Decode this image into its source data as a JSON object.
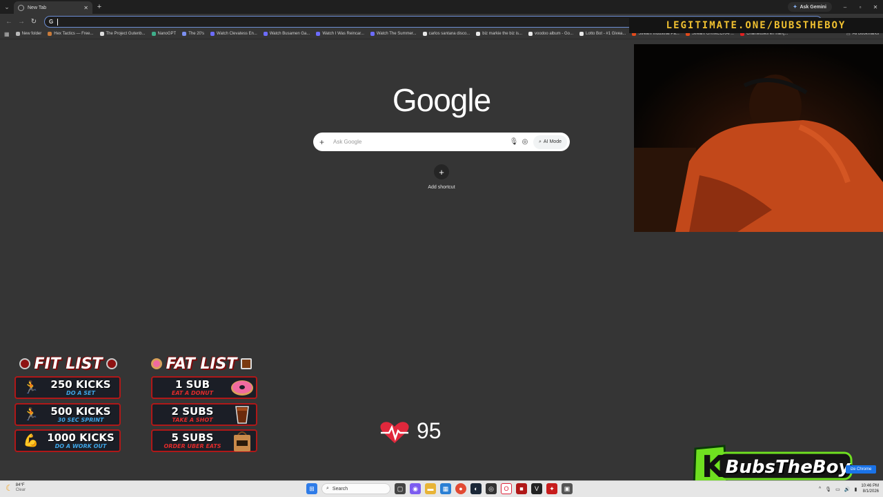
{
  "browser": {
    "tab_title": "New Tab",
    "new_tab_label": "+",
    "ask_gemini_label": "Ask Gemini",
    "omnibox_value": "",
    "window_controls": [
      "–",
      "▫",
      "✕"
    ]
  },
  "bookmarks": [
    {
      "label": "New folder",
      "color": "#b9b9b9"
    },
    {
      "label": "Hex Tactics — Free...",
      "color": "#c97b3a"
    },
    {
      "label": "The Project Gutenb...",
      "color": "#dcdcdc"
    },
    {
      "label": "NanoGPT",
      "color": "#3fae8a"
    },
    {
      "label": "The 20's",
      "color": "#7c8ff0"
    },
    {
      "label": "Watch Clevatess En...",
      "color": "#6c6cff"
    },
    {
      "label": "Watch Busamen Ga...",
      "color": "#6c6cff"
    },
    {
      "label": "Watch I Was Reincar...",
      "color": "#6c6cff"
    },
    {
      "label": "Watch The Summer...",
      "color": "#6c6cff"
    },
    {
      "label": "carlos santana disco...",
      "color": "#e8e8e8"
    },
    {
      "label": "biz markie the biz is...",
      "color": "#e8e8e8"
    },
    {
      "label": "voodoo album - Go...",
      "color": "#e8e8e8"
    },
    {
      "label": "Lotto Bot - #1 Givea...",
      "color": "#e8e8e8"
    },
    {
      "label": "Stream Industrial Pa...",
      "color": "#e24a1b"
    },
    {
      "label": "Stream GRIMECRAF...",
      "color": "#e24a1b"
    },
    {
      "label": "Chanteuses en franç...",
      "color": "#e02020"
    }
  ],
  "all_bookmarks_label": "All Bookmarks",
  "ntp": {
    "logo": "Google",
    "search_placeholder": "Ask Google",
    "ai_mode_label": "AI Mode",
    "add_shortcut_label": "Add shortcut"
  },
  "overlay": {
    "url": "LEGITIMATE.ONE/BUBSTHEBOY",
    "heart_rate": "95",
    "logo_text": "BubsTheBoy",
    "logo_letter": "K",
    "minimize_chip": "ize Chrome"
  },
  "fit_list": {
    "title": "FIT LIST",
    "items": [
      {
        "main": "250 KICKS",
        "sub": "DO A SET"
      },
      {
        "main": "500 KICKS",
        "sub": "30 SEC SPRINT"
      },
      {
        "main": "1000 KICKS",
        "sub": "DO A WORK OUT"
      }
    ]
  },
  "fat_list": {
    "title": "FAT LIST",
    "items": [
      {
        "main": "1 SUB",
        "sub": "EAT A DONUT"
      },
      {
        "main": "2 SUBS",
        "sub": "TAKE A SHOT"
      },
      {
        "main": "5 SUBS",
        "sub": "ORDER UBER EATS"
      }
    ]
  },
  "taskbar": {
    "weather_temp": "84°F",
    "weather_cond": "Clear",
    "search_label": "Search",
    "time": "10:46 PM",
    "date": "8/1/2026"
  }
}
